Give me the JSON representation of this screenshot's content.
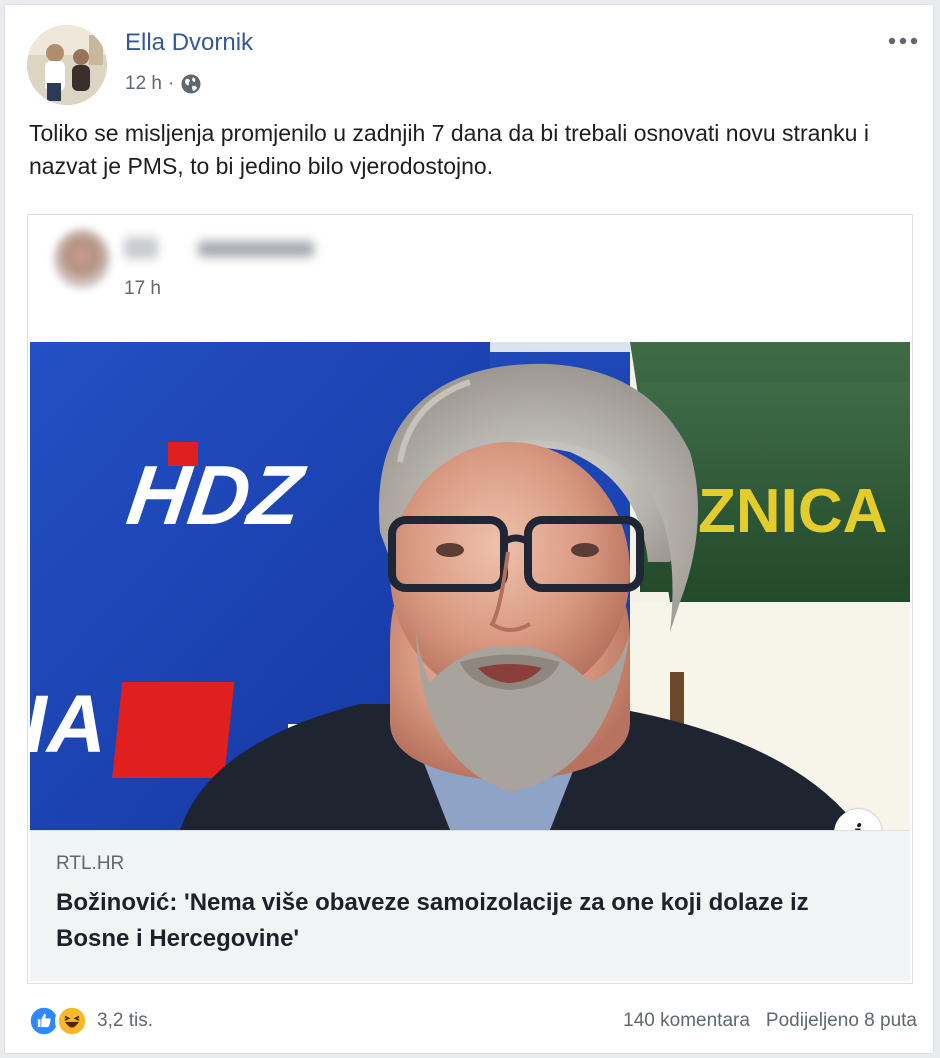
{
  "post": {
    "author": "Ella Dvornik",
    "time": "12 h",
    "separator": "·",
    "privacy_icon": "globe-icon",
    "text": "Toliko se misljenja promjenilo u zadnjih 7 dana da bi trebali osnovati novu stranku i nazvat je PMS, to bi jedino bilo vjerodostojno."
  },
  "shared_post": {
    "time": "17 h"
  },
  "link_preview": {
    "source": "RTL.HR",
    "headline": "Božinović: 'Nema više obaveze samoizolacije za one koji dolaze iz Bosne i Hercegovine'",
    "photo_sign_left": "HDZ",
    "photo_sign_left_bottom": "IA",
    "photo_sign_right": "ZNICA"
  },
  "footer": {
    "reaction_count": "3,2 tis.",
    "comments": "140 komentara",
    "shares": "Podijeljeno 8 puta",
    "reaction_icons": [
      "like-icon",
      "haha-icon"
    ]
  },
  "colors": {
    "link_blue": "#365899",
    "meta_gray": "#606770",
    "hdz_blue": "#1a3fa6",
    "hdz_red": "#e0201f",
    "banner_green": "#2e5c35",
    "banner_yellow": "#e3cc2e"
  }
}
